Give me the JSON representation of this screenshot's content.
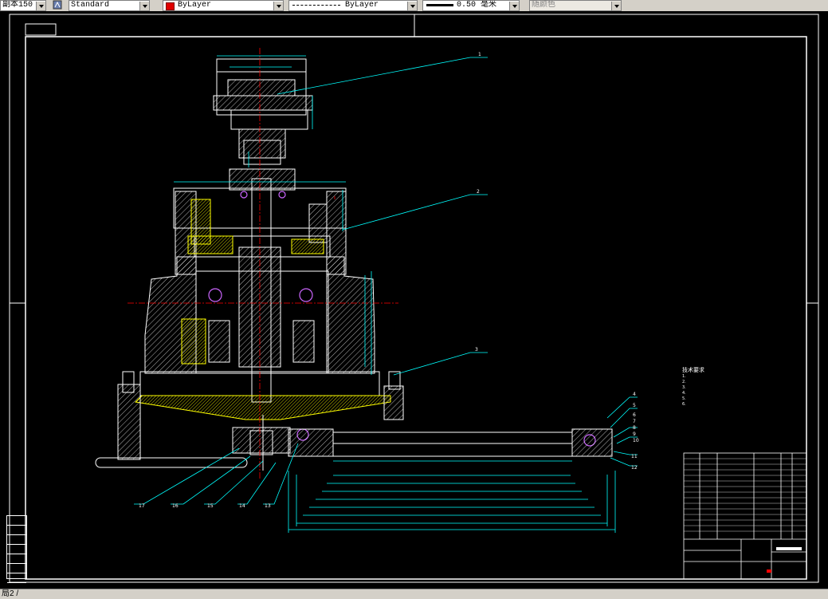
{
  "toolbar": {
    "dimstyle_value": "副本150",
    "textstyle_value": "Standard",
    "color_value": "ByLayer",
    "color_swatch": "#e00000",
    "linetype_value": "ByLayer",
    "lineweight_value": "0.50 毫米",
    "plotstyle_value": "随颜色",
    "icons": [
      "dimension-style-icon",
      "text-style-icon",
      "color-swatch-icon",
      "lineweight-icon"
    ]
  },
  "status": {
    "command_text": "局2 /"
  },
  "tech_notes": {
    "title": "技术要求",
    "lines": [
      "1.",
      "2.",
      "3.",
      "4.",
      "5.",
      "6."
    ]
  },
  "balloons": [
    "1",
    "2",
    "3",
    "4",
    "5",
    "6",
    "7",
    "8",
    "9",
    "10",
    "11",
    "12",
    "13",
    "14",
    "15",
    "16",
    "17"
  ],
  "colors": {
    "background": "#000000",
    "linework": "#ffffff",
    "dimensions": "#00ffff",
    "hatch_yellow": "#ffff00",
    "centerline_red": "#ff0000",
    "bearing_purple": "#cc66ff",
    "toolbar_gray": "#d4d0c8"
  }
}
